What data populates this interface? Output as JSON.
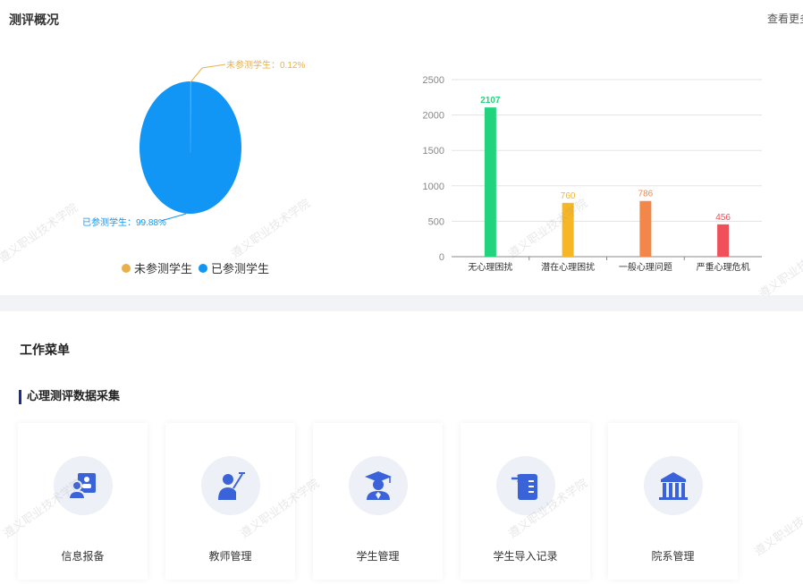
{
  "overview": {
    "title": "测评概况",
    "more_link": "查看更多"
  },
  "legend": [
    {
      "label": "未参测学生",
      "color": "#e8b04b"
    },
    {
      "label": "已参测学生",
      "color": "#1296f5"
    }
  ],
  "chart_data": [
    {
      "type": "pie",
      "slices": [
        {
          "label": "未参测学生",
          "percent_label": "未参测学生：0.12%",
          "value": 0.12,
          "color": "#e8b04b"
        },
        {
          "label": "已参测学生",
          "percent_label": "已参测学生：99.88%",
          "value": 99.88,
          "color": "#1296f5"
        }
      ]
    },
    {
      "type": "bar",
      "categories": [
        "无心理困扰",
        "潜在心理困扰",
        "一般心理问题",
        "严重心理危机"
      ],
      "values": [
        2107,
        760,
        786,
        456
      ],
      "colors": [
        "#22d37e",
        "#f7b623",
        "#f3874a",
        "#f0505a"
      ],
      "ylim": [
        0,
        2500
      ],
      "yticks": [
        0,
        500,
        1000,
        1500,
        2000,
        2500
      ],
      "grid": true
    }
  ],
  "menu": {
    "title": "工作菜单",
    "section_title": "心理测评数据采集",
    "items": [
      {
        "label": "信息报备",
        "icon": "id-card-icon"
      },
      {
        "label": "教师管理",
        "icon": "teacher-icon"
      },
      {
        "label": "学生管理",
        "icon": "graduate-icon"
      },
      {
        "label": "学生导入记录",
        "icon": "import-record-icon"
      },
      {
        "label": "院系管理",
        "icon": "building-icon"
      }
    ]
  },
  "watermark": "遵义职业技术学院"
}
